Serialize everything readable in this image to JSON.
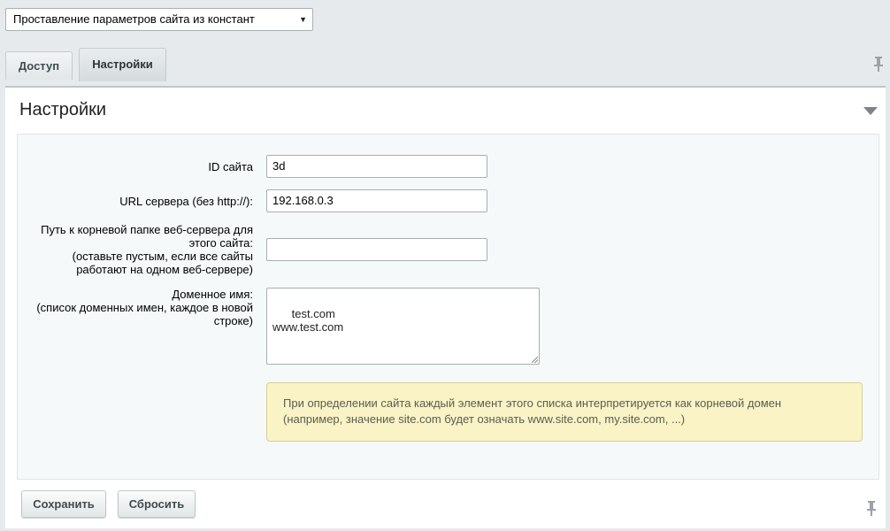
{
  "site_select": {
    "value": "Проставление параметров сайта из констант"
  },
  "tabs": [
    {
      "label": "Доступ",
      "active": false
    },
    {
      "label": "Настройки",
      "active": true
    }
  ],
  "panel": {
    "title": "Настройки",
    "fields": {
      "site_id": {
        "label": "ID сайта",
        "value": "3d"
      },
      "server_url": {
        "label": "URL сервера (без http://):",
        "value": "192.168.0.3"
      },
      "root_path": {
        "label_line1": "Путь к корневой папке веб-сервера для",
        "label_line2": "этого сайта:",
        "label_line3": "(оставьте пустым, если все сайты",
        "label_line4": "работают на одном веб-сервере)",
        "value": ""
      },
      "domain": {
        "label_line1": "Доменное имя:",
        "label_line2": "(список доменных имен, каждое в новой",
        "label_line3": "строке)",
        "value": "test.com\nwww.test.com"
      }
    },
    "hint_line1": "При определении сайта каждый элемент этого списка интерпретируется как корневой домен",
    "hint_line2": "(например, значение site.com будет означать www.site.com, my.site.com, ...)"
  },
  "buttons": {
    "save": "Сохранить",
    "reset": "Сбросить"
  },
  "colors": {
    "hint_bg": "#f9f3c6",
    "form_bg": "#f5f9f9",
    "page_bg": "#e6eaec"
  }
}
